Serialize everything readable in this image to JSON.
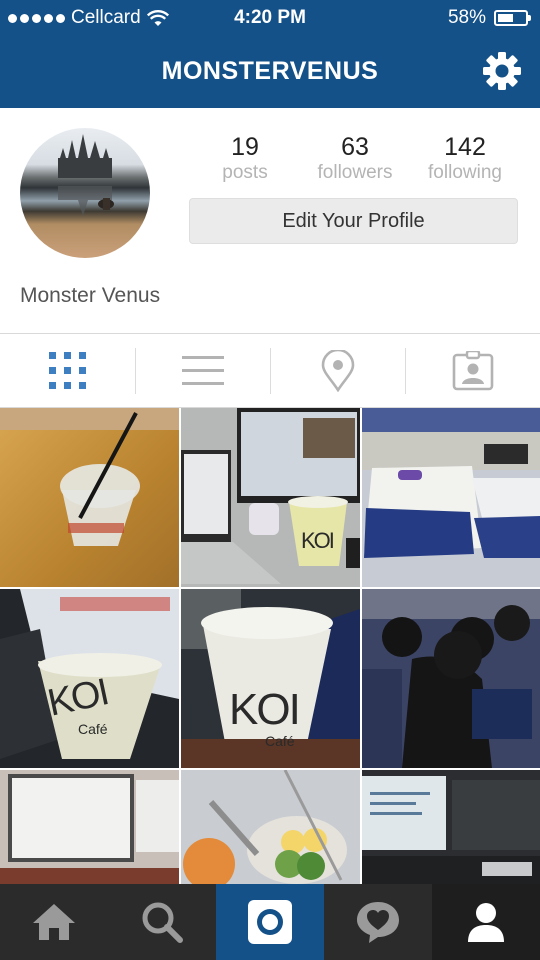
{
  "status": {
    "carrier": "Cellcard",
    "time": "4:20 PM",
    "battery": "58%",
    "battery_level": 0.58
  },
  "header": {
    "title": "MONSTERVENUS",
    "settings_icon": "gear-icon"
  },
  "profile": {
    "stats": [
      {
        "value": "19",
        "label": "posts"
      },
      {
        "value": "63",
        "label": "followers"
      },
      {
        "value": "142",
        "label": "following"
      }
    ],
    "edit_label": "Edit Your Profile",
    "full_name": "Monster Venus"
  },
  "tabs": [
    "grid-icon",
    "list-icon",
    "location-pin-icon",
    "tagged-photos-icon"
  ],
  "photo_text": {
    "brand": "KOI",
    "cafe": "Café"
  },
  "bottom_nav": [
    "home-icon",
    "search-icon",
    "camera-icon",
    "activity-icon",
    "profile-icon"
  ],
  "colors": {
    "brand": "#145189",
    "tab_active": "#3e7fc1",
    "bottom_bar": "#2b2b2b"
  }
}
